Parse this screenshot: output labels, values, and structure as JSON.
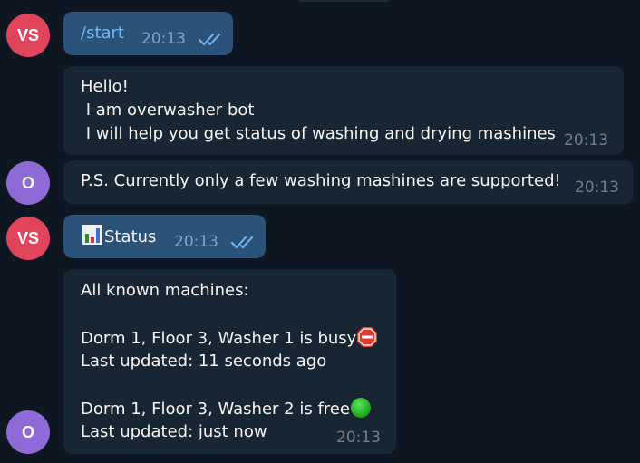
{
  "messages": [
    {
      "sender_initials": "VS",
      "text": "/start",
      "time": "20:13",
      "read_icon": "double-check-icon"
    },
    {
      "text": "Hello!\n I am overwasher bot\n I will help you get status of washing and drying mashines",
      "time": "20:13"
    },
    {
      "sender_initials": "O",
      "text": "P.S. Currently only a few washing mashines are supported!",
      "time": "20:13"
    },
    {
      "sender_initials": "VS",
      "icon": "bar-chart-icon",
      "text": "Status",
      "time": "20:13",
      "read_icon": "double-check-icon"
    },
    {
      "sender_initials": "O",
      "heading": "All known machines:",
      "machines": [
        {
          "line": "Dorm 1, Floor 3, Washer 1 is busy",
          "status_icon": "stop-sign-icon",
          "updated": "Last updated: 11 seconds ago"
        },
        {
          "line": "Dorm 1, Floor 3, Washer 2 is free",
          "status_icon": "green-circle-icon",
          "updated": "Last updated: just now"
        }
      ],
      "time": "20:13"
    }
  ],
  "colors": {
    "background": "#0e1621",
    "outgoing_bubble": "#2b5278",
    "incoming_bubble": "#182533",
    "avatar_vs": "#e1455b",
    "avatar_o": "#8e6ad6",
    "command_link": "#74b8f6"
  }
}
